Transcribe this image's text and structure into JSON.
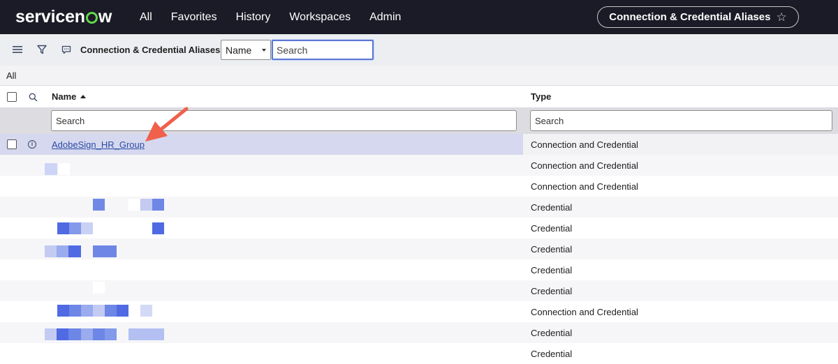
{
  "app": {
    "logo_pre": "servicen",
    "logo_post": "w",
    "nav": [
      "All",
      "Favorites",
      "History",
      "Workspaces",
      "Admin"
    ],
    "context_title": "Connection & Credential Aliases"
  },
  "toolbar": {
    "list_title": "Connection & Credential Aliases",
    "field_select": "Name",
    "search_placeholder": "Search"
  },
  "breadcrumb": "All",
  "table": {
    "columns": [
      "Name",
      "Type"
    ],
    "filter_placeholder": "Search",
    "rows": [
      {
        "name": "AdobeSign_HR_Group",
        "type": "Connection and Credential"
      },
      {
        "name": "",
        "type": "Connection and Credential"
      },
      {
        "name": "",
        "type": "Connection and Credential"
      },
      {
        "name": "",
        "type": "Credential"
      },
      {
        "name": "",
        "type": "Credential"
      },
      {
        "name": "",
        "type": "Credential"
      },
      {
        "name": "",
        "type": "Credential"
      },
      {
        "name": "",
        "type": "Credential"
      },
      {
        "name": "",
        "type": "Connection and Credential"
      },
      {
        "name": "",
        "type": "Credential"
      },
      {
        "name": "",
        "type": "Credential"
      }
    ]
  },
  "colors": {
    "topbar": "#1a1b26",
    "accent_green": "#62d84e",
    "link": "#2c4ba7",
    "selected_row": "#d5d8ee",
    "annotation_arrow": "#f0604b"
  }
}
